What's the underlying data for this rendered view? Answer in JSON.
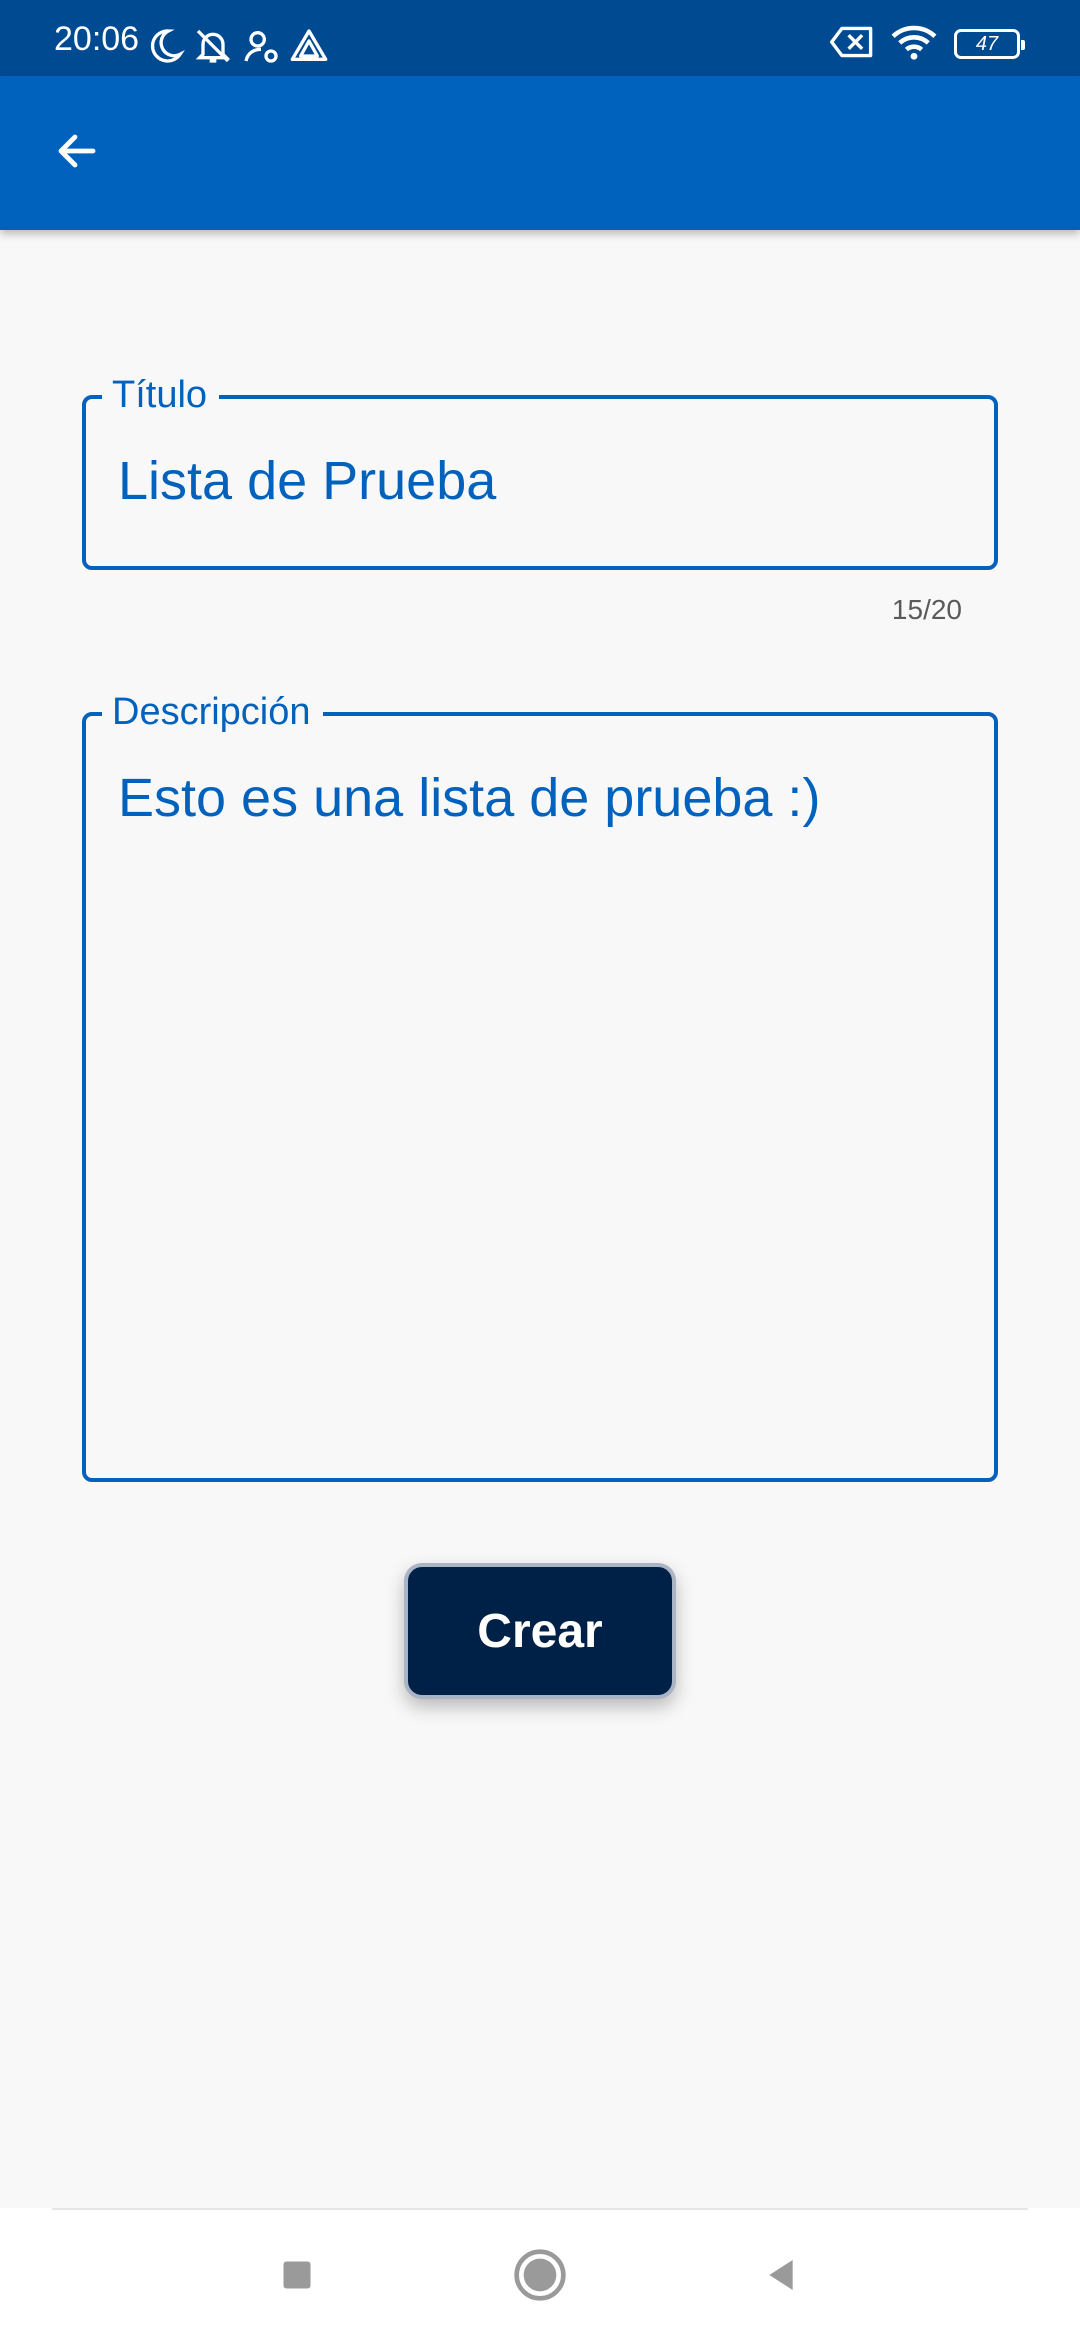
{
  "status_bar": {
    "time": "20:06",
    "battery_level": "47",
    "left_icons": [
      "moon-icon",
      "bell-off-icon",
      "person-icon",
      "drive-icon"
    ],
    "right_icons": [
      "sim-error-icon",
      "wifi-icon",
      "battery-icon"
    ]
  },
  "app_bar": {
    "back_icon": "arrow-back-icon",
    "color": "#0062bd"
  },
  "form": {
    "title_field": {
      "label": "Título",
      "value": "Lista de Prueba",
      "counter": "15/20"
    },
    "description_field": {
      "label": "Descripción",
      "value": "Esto es una lista de prueba :)"
    },
    "create_button": "Crear"
  },
  "nav_bar": {
    "buttons": [
      "recents-square-icon",
      "home-circle-icon",
      "back-triangle-icon"
    ]
  },
  "colors": {
    "status_bar": "#004a92",
    "accent": "#0062bd",
    "button": "#002147",
    "background": "#f8f8f8"
  }
}
